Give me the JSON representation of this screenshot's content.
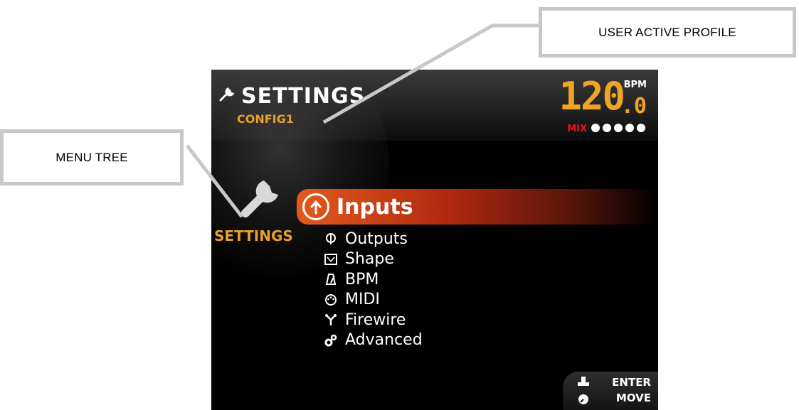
{
  "callouts": {
    "user_active_profile": "USER ACTIVE PROFILE",
    "menu_tree": "MENU TREE"
  },
  "header": {
    "title": "SETTINGS",
    "profile": "CONFIG1",
    "bpm_value": "120",
    "bpm_decimal": ".0",
    "bpm_unit": "BPM",
    "mix_label": "MIX",
    "mix_level_dots": 5
  },
  "sidebar": {
    "label": "SETTINGS",
    "icon": "wrench-icon"
  },
  "menu": {
    "selected": {
      "label": "Inputs",
      "icon": "inputs-icon"
    },
    "items": [
      {
        "label": "Outputs",
        "icon": "outputs-icon"
      },
      {
        "label": "Shape",
        "icon": "shape-icon"
      },
      {
        "label": "BPM",
        "icon": "metronome-icon"
      },
      {
        "label": "MIDI",
        "icon": "midi-icon"
      },
      {
        "label": "Firewire",
        "icon": "firewire-icon"
      },
      {
        "label": "Advanced",
        "icon": "gears-icon"
      }
    ]
  },
  "footer": {
    "enter_label": "ENTER",
    "move_label": "MOVE"
  },
  "colors": {
    "accent_orange": "#e8a02a",
    "selection_red": "#b52a10",
    "mix_red": "#e0161c",
    "callout_border": "#c8c8c8"
  }
}
